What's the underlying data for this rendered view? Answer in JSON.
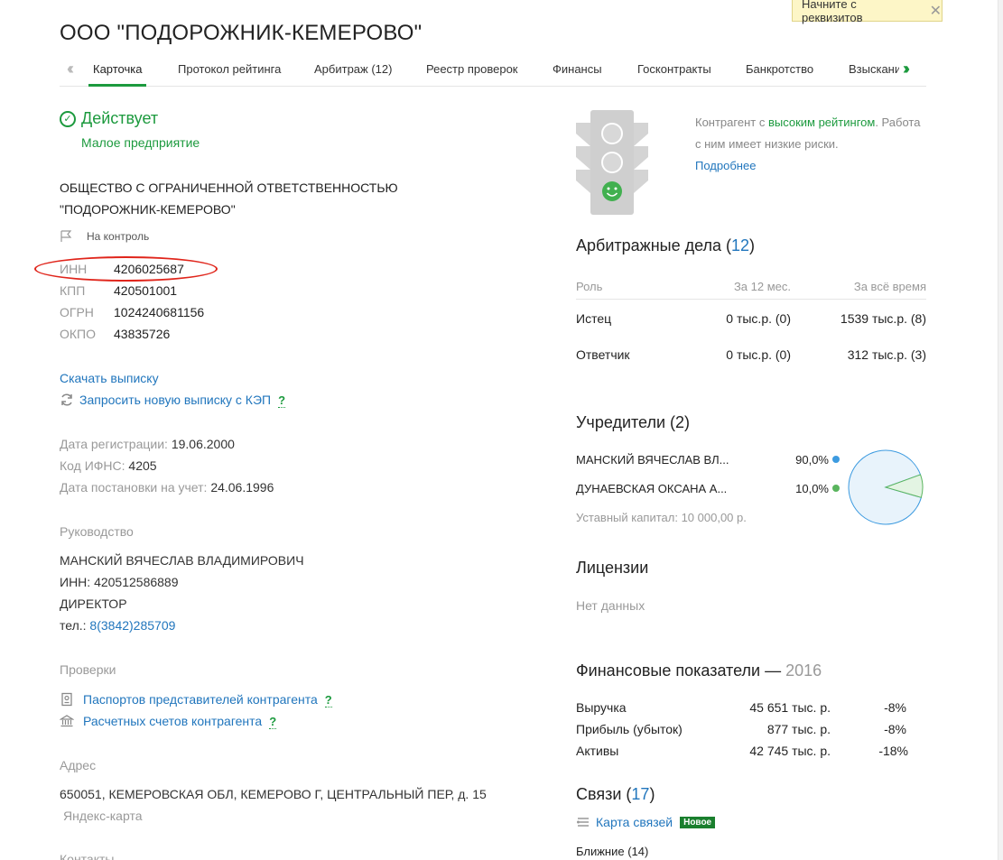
{
  "tooltip": {
    "text": "Начните с реквизитов",
    "close": "✕"
  },
  "company": {
    "title": "ООО \"ПОДОРОЖНИК-КЕМЕРОВО\""
  },
  "tabs": [
    {
      "label": "Карточка"
    },
    {
      "label": "Протокол рейтинга"
    },
    {
      "label": "Арбитраж (12)"
    },
    {
      "label": "Реестр проверок"
    },
    {
      "label": "Финансы"
    },
    {
      "label": "Госконтракты"
    },
    {
      "label": "Банкротство"
    },
    {
      "label": "Взыскани"
    }
  ],
  "status": {
    "label": "Действует",
    "size": "Малое предприятие"
  },
  "full_name": {
    "line1": "ОБЩЕСТВО С ОГРАНИЧЕННОЙ ОТВЕТСТВЕННОСТЬЮ",
    "line2": "\"ПОДОРОЖНИК-КЕМЕРОВО\""
  },
  "control": {
    "label": "На контроль"
  },
  "codes": [
    {
      "key": "ИНН",
      "value": "4206025687"
    },
    {
      "key": "КПП",
      "value": "420501001"
    },
    {
      "key": "ОГРН",
      "value": "1024240681156"
    },
    {
      "key": "ОКПО",
      "value": "43835726"
    }
  ],
  "extract": {
    "download": "Скачать выписку",
    "request": "Запросить новую выписку с КЭП",
    "q": "?"
  },
  "registration": {
    "date_label": "Дата регистрации:",
    "date_value": "19.06.2000",
    "ifns_label": "Код ИФНС:",
    "ifns_value": "4205",
    "tax_label": "Дата постановки на учет:",
    "tax_value": "24.06.1996"
  },
  "management": {
    "heading": "Руководство",
    "name": "МАНСКИЙ ВЯЧЕСЛАВ ВЛАДИМИРОВИЧ",
    "inn": "ИНН: 420512586889",
    "position": "ДИРЕКТОР",
    "phone_label": "тел.:",
    "phone": "8(3842)285709"
  },
  "checks": {
    "heading": "Проверки",
    "passports": "Паспортов представителей контрагента",
    "accounts": "Расчетных счетов контрагента",
    "q": "?"
  },
  "address": {
    "heading": "Адрес",
    "value": "650051, КЕМЕРОВСКАЯ ОБЛ, КЕМЕРОВО Г, ЦЕНТРАЛЬНЫЙ ПЕР, д. 15",
    "map": "Яндекс-карта"
  },
  "contacts": {
    "heading": "Контакты"
  },
  "risk": {
    "prefix": "Контрагент с ",
    "link": "высоким рейтингом",
    "suffix": ". Работа",
    "line2": "с ним имеет низкие риски.",
    "more": "Подробнее",
    "smile": "☺"
  },
  "arbitration": {
    "title": "Арбитражные дела (",
    "count": "12",
    "close": ")",
    "headers": [
      "Роль",
      "За 12 мес.",
      "За всё время"
    ],
    "rows": [
      {
        "role": "Истец",
        "year": "0 тыс.р. (0)",
        "all": "1539 тыс.р. (8)"
      },
      {
        "role": "Ответчик",
        "year": "0 тыс.р. (0)",
        "all": "312 тыс.р. (3)"
      }
    ]
  },
  "founders": {
    "title": "Учредители (2)",
    "items": [
      {
        "name": "МАНСКИЙ ВЯЧЕСЛАВ ВЛ...",
        "share": "90,0%"
      },
      {
        "name": "ДУНАЕВСКАЯ ОКСАНА А...",
        "share": "10,0%"
      }
    ],
    "capital": "Уставный капитал: 10 000,00 р.",
    "colors": {
      "first": "#3d9be0",
      "second": "#5ab55e"
    }
  },
  "chart_data": {
    "type": "pie",
    "categories": [
      "МАНСКИЙ ВЯЧЕСЛАВ ВЛ...",
      "ДУНАЕВСКАЯ ОКСАНА А..."
    ],
    "values": [
      90.0,
      10.0
    ]
  },
  "licenses": {
    "title": "Лицензии",
    "value": "Нет данных"
  },
  "finance": {
    "title": "Финансовые показатели — ",
    "year": "2016",
    "rows": [
      {
        "label": "Выручка",
        "value": "45 651 тыс. р.",
        "delta": "-8%"
      },
      {
        "label": "Прибыль (убыток)",
        "value": "877 тыс. р.",
        "delta": "-8%"
      },
      {
        "label": "Активы",
        "value": "42 745 тыс. р.",
        "delta": "-18%"
      }
    ]
  },
  "links": {
    "title": "Связи (",
    "count": "17",
    "close": ")",
    "map": "Карта связей",
    "badge": "Новое",
    "near": "Ближние (14)"
  }
}
